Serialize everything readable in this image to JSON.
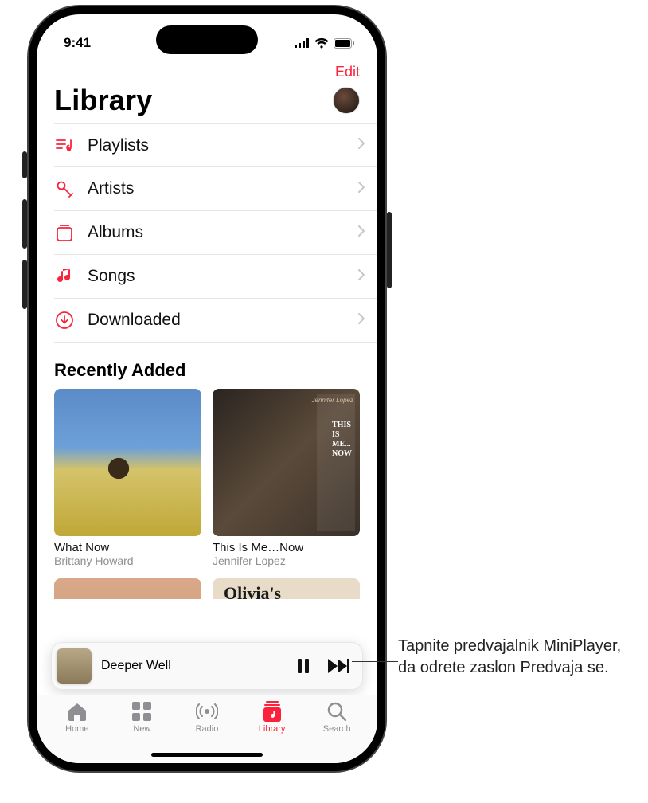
{
  "status": {
    "time": "9:41"
  },
  "nav": {
    "edit": "Edit"
  },
  "header": {
    "title": "Library"
  },
  "library_sections": [
    {
      "label": "Playlists",
      "icon": "playlist-icon"
    },
    {
      "label": "Artists",
      "icon": "mic-icon"
    },
    {
      "label": "Albums",
      "icon": "album-icon"
    },
    {
      "label": "Songs",
      "icon": "note-icon"
    },
    {
      "label": "Downloaded",
      "icon": "download-icon"
    }
  ],
  "recently_added": {
    "title": "Recently Added",
    "albums": [
      {
        "title": "What Now",
        "artist": "Brittany Howard"
      },
      {
        "title": "This Is Me…Now",
        "artist": "Jennifer Lopez",
        "cover_signature": "Jennifer Lopez",
        "cover_text": "THIS\nIS\nME...\nNOW"
      }
    ],
    "partial_row": [
      {
        "title_fragment": ""
      },
      {
        "title_fragment": "Olivia's"
      }
    ]
  },
  "mini_player": {
    "track": "Deeper Well"
  },
  "tabs": [
    {
      "label": "Home",
      "icon": "home-icon",
      "active": false
    },
    {
      "label": "New",
      "icon": "grid-icon",
      "active": false
    },
    {
      "label": "Radio",
      "icon": "radio-icon",
      "active": false
    },
    {
      "label": "Library",
      "icon": "library-icon",
      "active": true
    },
    {
      "label": "Search",
      "icon": "search-icon",
      "active": false
    }
  ],
  "callout": {
    "text": "Tapnite predvajalnik MiniPlayer, da odrete zaslon Predvaja se."
  },
  "colors": {
    "accent": "#fa233b"
  }
}
